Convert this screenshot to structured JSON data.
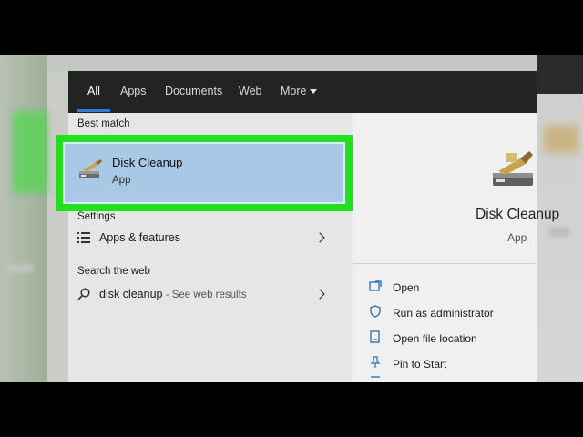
{
  "tabs": [
    {
      "label": "All"
    },
    {
      "label": "Apps"
    },
    {
      "label": "Documents"
    },
    {
      "label": "Web"
    },
    {
      "label": "More"
    }
  ],
  "sections": {
    "best_match": "Best match",
    "settings": "Settings",
    "search_web": "Search the web"
  },
  "best_match": {
    "title": "Disk Cleanup",
    "type": "App"
  },
  "settings_item": {
    "label": "Apps & features"
  },
  "web_item": {
    "query": "disk cleanup",
    "suffix": " - See web results"
  },
  "preview": {
    "title": "Disk Cleanup",
    "type": "App"
  },
  "actions": [
    {
      "label": "Open",
      "icon": "open-icon"
    },
    {
      "label": "Run as administrator",
      "icon": "shield-icon"
    },
    {
      "label": "Open file location",
      "icon": "file-location-icon"
    },
    {
      "label": "Pin to Start",
      "icon": "pin-icon"
    }
  ],
  "colors": {
    "highlight": "#22e01e",
    "selection": "#a8c8e6",
    "accent": "#2b7fd8",
    "nav_bg": "#232323"
  }
}
